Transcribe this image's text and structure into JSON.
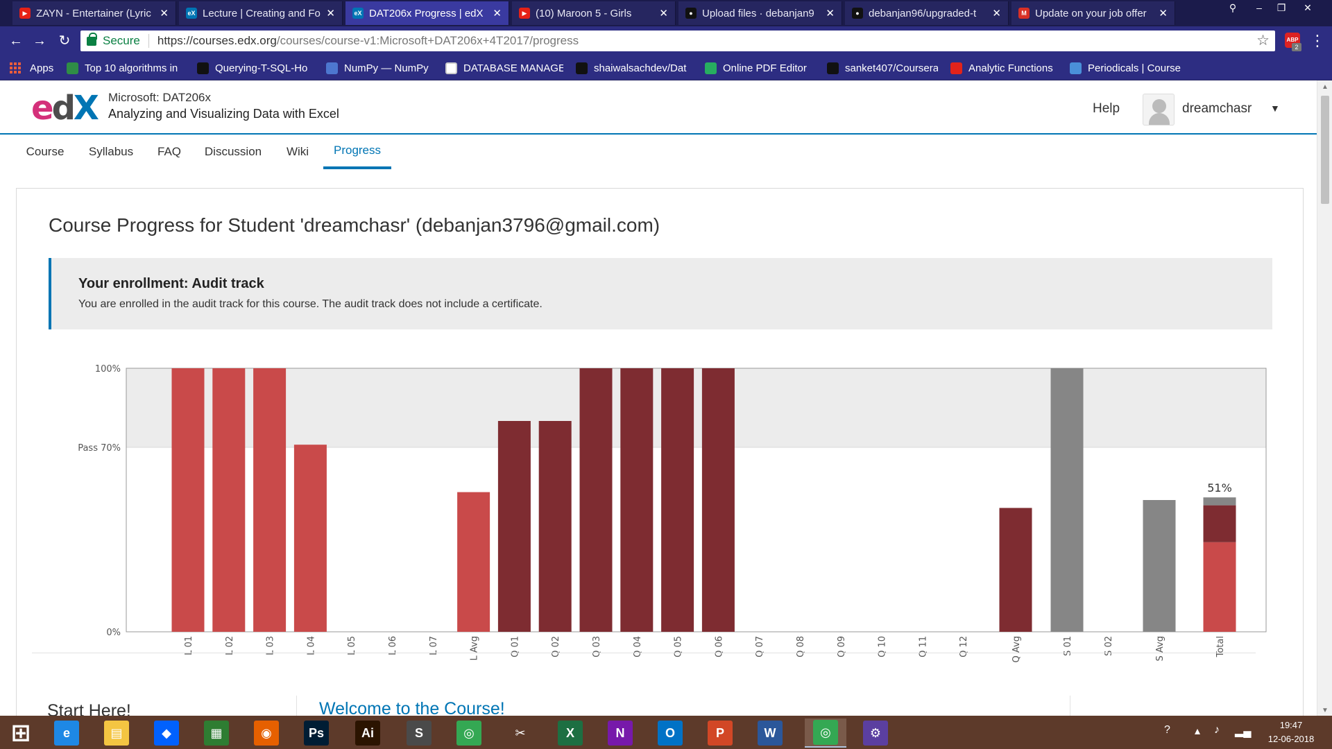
{
  "browser": {
    "tabs": [
      {
        "title": "ZAYN - Entertainer (Lyric",
        "icon": "youtube-icon",
        "color": "#e62117",
        "glyph": "▶"
      },
      {
        "title": "Lecture | Creating and Fo",
        "icon": "edx-icon",
        "color": "#0075b4",
        "glyph": "eX"
      },
      {
        "title": "DAT206x Progress | edX",
        "icon": "edx-icon",
        "color": "#0075b4",
        "glyph": "eX"
      },
      {
        "title": "(10) Maroon 5 - Girls",
        "icon": "youtube-icon",
        "color": "#e62117",
        "glyph": "▶"
      },
      {
        "title": "Upload files · debanjan9",
        "icon": "github-icon",
        "color": "#111111",
        "glyph": "●"
      },
      {
        "title": "debanjan96/upgraded-t",
        "icon": "github-icon",
        "color": "#111111",
        "glyph": "●"
      },
      {
        "title": "Update on your job offer",
        "icon": "gmail-icon",
        "color": "#d93025",
        "glyph": "M"
      }
    ],
    "address": {
      "secure_label": "Secure",
      "url_host": "https://courses.edx.org",
      "url_path": "/courses/course-v1:Microsoft+DAT206x+4T2017/progress"
    },
    "abp_count": "2",
    "bookmarks": [
      {
        "label": "Apps",
        "icon": "apps-icon",
        "color": ""
      },
      {
        "label": "Top 10 algorithms in",
        "icon": "geeks-icon",
        "color": "#2f8d46"
      },
      {
        "label": "Querying-T-SQL-Ho",
        "icon": "github-icon",
        "color": "#111111"
      },
      {
        "label": "NumPy — NumPy",
        "icon": "numpy-icon",
        "color": "#4d77cf"
      },
      {
        "label": "DATABASE MANAGE",
        "icon": "document-icon",
        "color": "#ffffff"
      },
      {
        "label": "shaiwalsachdev/Dat",
        "icon": "github-icon",
        "color": "#111111"
      },
      {
        "label": "Online PDF Editor",
        "icon": "sejda-icon",
        "color": "#27ae60"
      },
      {
        "label": "sanket407/Coursera",
        "icon": "github-icon",
        "color": "#111111"
      },
      {
        "label": "Analytic Functions",
        "icon": "oracle-icon",
        "color": "#e2231a"
      },
      {
        "label": "Periodicals | Course",
        "icon": "infinity-icon",
        "color": "#4a90d9"
      }
    ]
  },
  "header": {
    "course_org": "Microsoft: DAT206x",
    "course_name": "Analyzing and Visualizing Data with Excel",
    "help": "Help",
    "username": "dreamchasr"
  },
  "course_tabs": [
    "Course",
    "Syllabus",
    "FAQ",
    "Discussion",
    "Wiki",
    "Progress"
  ],
  "progress": {
    "title": "Course Progress for Student 'dreamchasr' (debanjan3796@gmail.com)",
    "enrollment_title": "Your enrollment: Audit track",
    "enrollment_text": "You are enrolled in the audit track for this course. The audit track does not include a certificate."
  },
  "chart_data": {
    "type": "bar",
    "categories": [
      "L 01",
      "L 02",
      "L 03",
      "L 04",
      "L 05",
      "L 06",
      "L 07",
      "L Avg",
      "Q 01",
      "Q 02",
      "Q 03",
      "Q 04",
      "Q 05",
      "Q 06",
      "Q 07",
      "Q 08",
      "Q 09",
      "Q 10",
      "Q 11",
      "Q 12",
      "Q Avg",
      "S 01",
      "S 02",
      "S Avg",
      "Total"
    ],
    "values": [
      100,
      100,
      100,
      71,
      0,
      0,
      0,
      53,
      80,
      80,
      100,
      100,
      100,
      100,
      0,
      0,
      0,
      0,
      0,
      0,
      47,
      100,
      0,
      50,
      51
    ],
    "category_group": [
      "L",
      "L",
      "L",
      "L",
      "L",
      "L",
      "L",
      "L",
      "Q",
      "Q",
      "Q",
      "Q",
      "Q",
      "Q",
      "Q",
      "Q",
      "Q",
      "Q",
      "Q",
      "Q",
      "Q",
      "S",
      "S",
      "S",
      "T"
    ],
    "total_stack": [
      34,
      14,
      3
    ],
    "total_label": "51%",
    "ytick_labels": [
      "100%",
      "Pass 70%",
      "0%"
    ],
    "ytick_values": [
      100,
      70,
      0
    ],
    "ylim": [
      0,
      100
    ],
    "pass_line": 70,
    "colors": {
      "L": "#c94a4a",
      "Q": "#7e2c31",
      "S": "#868686",
      "band": "#ececec"
    }
  },
  "bottom": {
    "start_here": "Start Here!",
    "welcome": "Welcome to the Course!"
  },
  "taskbar": {
    "apps": [
      {
        "name": "windows-start-icon",
        "glyph": "⊞",
        "color": "transparent"
      },
      {
        "name": "internet-explorer-icon",
        "glyph": "e",
        "color": "#1e88e5"
      },
      {
        "name": "file-explorer-icon",
        "glyph": "▤",
        "color": "#f4c542"
      },
      {
        "name": "dropbox-icon",
        "glyph": "◆",
        "color": "#0061fe"
      },
      {
        "name": "store-icon",
        "glyph": "▦",
        "color": "#2e7d32"
      },
      {
        "name": "firefox-icon",
        "glyph": "◉",
        "color": "#e66000"
      },
      {
        "name": "photoshop-icon",
        "glyph": "Ps",
        "color": "#001d34"
      },
      {
        "name": "illustrator-icon",
        "glyph": "Ai",
        "color": "#2b1400"
      },
      {
        "name": "sublime-icon",
        "glyph": "S",
        "color": "#4a4a4a"
      },
      {
        "name": "chrome-icon",
        "glyph": "◎",
        "color": "#34a853"
      },
      {
        "name": "snipping-tool-icon",
        "glyph": "✂",
        "color": "transparent"
      },
      {
        "name": "excel-icon",
        "glyph": "X",
        "color": "#1d6f42"
      },
      {
        "name": "onenote-icon",
        "glyph": "N",
        "color": "#7719aa"
      },
      {
        "name": "outlook-icon",
        "glyph": "O",
        "color": "#0072c6"
      },
      {
        "name": "powerpoint-icon",
        "glyph": "P",
        "color": "#d24726"
      },
      {
        "name": "word-icon",
        "glyph": "W",
        "color": "#2b579a"
      },
      {
        "name": "chrome-active-icon",
        "glyph": "◎",
        "color": "#34a853"
      },
      {
        "name": "settings-icon",
        "glyph": "⚙",
        "color": "#5b3fa0"
      }
    ],
    "time": "19:47",
    "date": "12-06-2018"
  }
}
